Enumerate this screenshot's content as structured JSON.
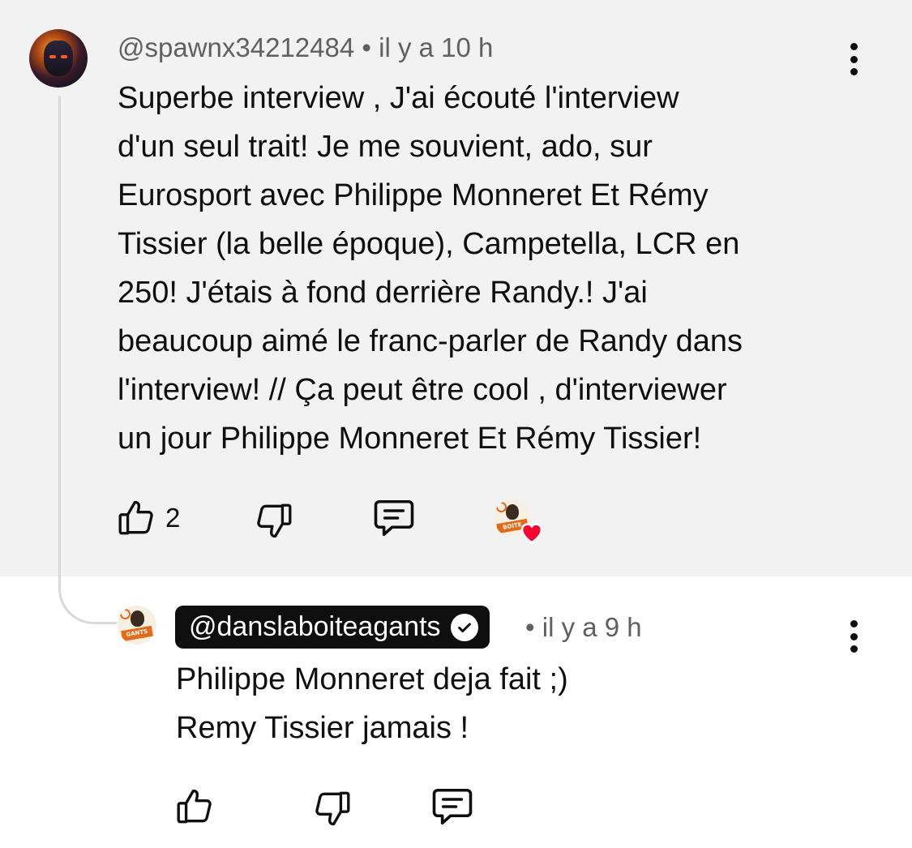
{
  "parent_comment": {
    "author": "@spawnx34212484",
    "time": "il y a 10 h",
    "text_lines": [
      "Superbe interview , J'ai écouté l'interview",
      "d'un seul trait! Je me souvient, ado, sur",
      "Eurosport avec Philippe Monneret Et Rémy",
      "Tissier (la belle époque), Campetella, LCR en",
      "250! J'étais à fond derrière Randy.! J'ai",
      "beaucoup aimé le franc-parler de Randy dans",
      "l'interview! // Ça peut être cool , d'interviewer",
      "un jour Philippe Monneret Et Rémy Tissier!"
    ],
    "like_count": "2",
    "creator_heart": true,
    "icons": {
      "like": "thumbs-up-icon",
      "dislike": "thumbs-down-icon",
      "reply": "comment-icon",
      "menu": "more-vertical-icon"
    }
  },
  "reply": {
    "author": "@danslaboiteagants",
    "verified": true,
    "time": "il y a 9 h",
    "text_lines": [
      "Philippe Monneret deja fait ;)",
      "Remy Tissier jamais !"
    ],
    "avatar_text": "BOITE À GANTS",
    "icons": {
      "like": "thumbs-up-icon",
      "dislike": "thumbs-down-icon",
      "reply": "comment-icon",
      "menu": "more-vertical-icon"
    }
  },
  "colors": {
    "parent_bg": "#f2f2f2",
    "meta_text": "#606060",
    "badge_bg": "#0f0f0f",
    "heart": "#ff0033",
    "brand_orange": "#e46a1a"
  }
}
